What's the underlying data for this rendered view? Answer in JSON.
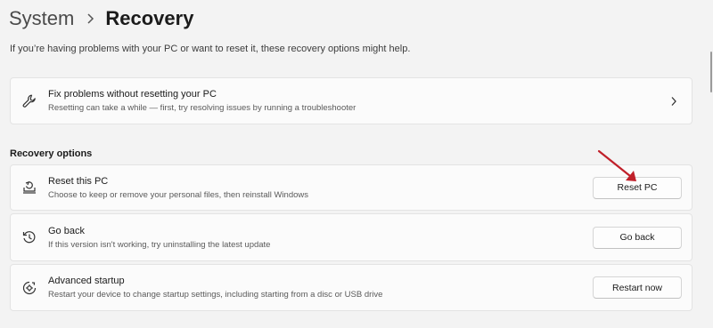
{
  "breadcrumb": {
    "parent": "System",
    "current": "Recovery"
  },
  "intro": "If you’re having problems with your PC or want to reset it, these recovery options might help.",
  "fix": {
    "title": "Fix problems without resetting your PC",
    "subtitle": "Resetting can take a while — first, try resolving issues by running a troubleshooter",
    "icon": "wrench-icon"
  },
  "section_title": "Recovery options",
  "options": [
    {
      "title": "Reset this PC",
      "subtitle": "Choose to keep or remove your personal files, then reinstall Windows",
      "button": "Reset PC",
      "icon": "reset-pc-icon"
    },
    {
      "title": "Go back",
      "subtitle": "If this version isn't working, try uninstalling the latest update",
      "button": "Go back",
      "icon": "history-icon"
    },
    {
      "title": "Advanced startup",
      "subtitle": "Restart your device to change startup settings, including starting from a disc or USB drive",
      "button": "Restart now",
      "icon": "advanced-startup-icon"
    }
  ],
  "colors": {
    "annotation_arrow": "#c0202a",
    "background": "#f3f3f3",
    "card": "#fbfbfb"
  }
}
